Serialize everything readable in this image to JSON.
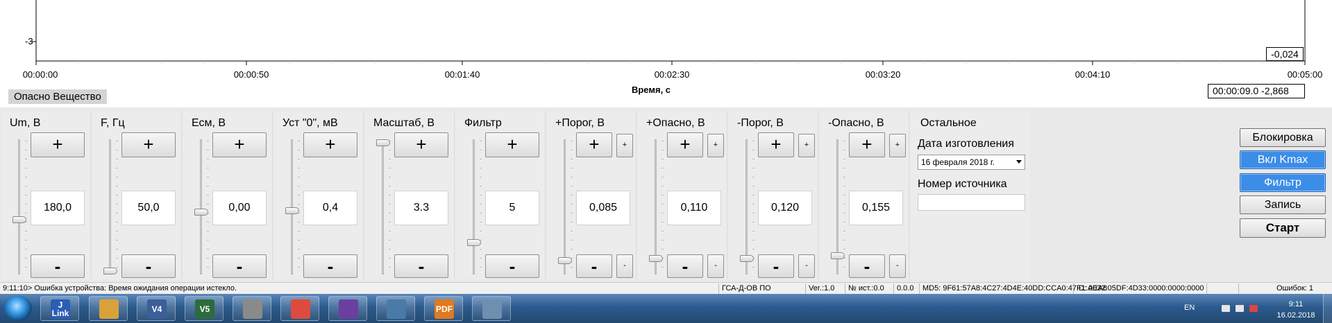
{
  "chart": {
    "y_ticks": [
      "-3"
    ],
    "x_ticks": [
      "00:00:00",
      "00:00:50",
      "00:01:40",
      "00:02:30",
      "00:03:20",
      "00:04:10",
      "00:05:00"
    ],
    "x_label": "Время, с",
    "value_box": "-0,024",
    "cursor_readout": "00:00:09.0  -2,868",
    "channel_label": "Опасно Вещество"
  },
  "panels": [
    {
      "title": "Um, В",
      "value": "180,0",
      "plus": "+",
      "minus": "-",
      "slider_level": 0.4
    },
    {
      "title": "F, Гц",
      "value": "50,0",
      "plus": "+",
      "minus": "-",
      "slider_level": 0.0
    },
    {
      "title": "Есм, В",
      "value": "0,00",
      "plus": "+",
      "minus": "-",
      "slider_level": 0.46
    },
    {
      "title": "Уст \"0\", мВ",
      "value": "0,4",
      "plus": "+",
      "minus": "-",
      "slider_level": 0.47
    },
    {
      "title": "Масштаб, В",
      "value": "3.3",
      "plus": "+",
      "minus": "-",
      "slider_level": 1.0
    },
    {
      "title": "Фильтр",
      "value": "5",
      "plus": "+",
      "minus": "-",
      "slider_level": 0.22
    },
    {
      "title": "+Порог, В",
      "value": "0,085",
      "plus": "+",
      "minus": "-",
      "small_plus": "+",
      "small_minus": "-",
      "slider_level": 0.08
    },
    {
      "title": "+Опасно, В",
      "value": "0,110",
      "plus": "+",
      "minus": "-",
      "small_plus": "+",
      "small_minus": "-",
      "slider_level": 0.1
    },
    {
      "title": "-Порог, В",
      "value": "0,120",
      "plus": "+",
      "minus": "-",
      "small_plus": "+",
      "small_minus": "-",
      "slider_level": 0.1
    },
    {
      "title": "-Опасно, В",
      "value": "0,155",
      "plus": "+",
      "minus": "-",
      "small_plus": "+",
      "small_minus": "-",
      "slider_level": 0.12
    }
  ],
  "other": {
    "title": "Остальное",
    "date_label": "Дата изготовления",
    "date_value": "16 февраля 2018 г.",
    "source_label": "Номер источника",
    "source_value": ""
  },
  "side_buttons": {
    "lock": "Блокировка",
    "kmax": "Вкл Kmax",
    "filter": "Фильтр",
    "record": "Запись",
    "start": "Старт"
  },
  "status_bar": {
    "message": "9:11:10> Ошибка устройства: Время ожидания операции истекло.",
    "device": "ГСА-Д-ОВ ПО",
    "version": "Ver.:1.0",
    "source_no": "№ ист.:0.0",
    "source_val": "0.0.0",
    "md5": "MD5: 9F61:57A8:4C27:4D4E:40DD:CCA0:47F1:AEA6",
    "id": "ID: 0032:05DF:4D33:0000:0000:0000",
    "errors": "Ошибок: 1"
  },
  "taskbar": {
    "apps": [
      {
        "icon": "jlink-icon",
        "text": "J\nLink"
      },
      {
        "icon": "file-explorer-icon",
        "text": ""
      },
      {
        "icon": "ide-v4-icon",
        "text": "V4"
      },
      {
        "icon": "ide-v5-icon",
        "text": "V5"
      },
      {
        "icon": "calculator-icon",
        "text": ""
      },
      {
        "icon": "chrome-icon",
        "text": ""
      },
      {
        "icon": "visual-studio-icon",
        "text": ""
      },
      {
        "icon": "tools-icon",
        "text": ""
      },
      {
        "icon": "pdf-icon",
        "text": "PDF"
      },
      {
        "icon": "network-app-icon",
        "text": ""
      }
    ],
    "lang": "EN",
    "time": "9:11",
    "date": "16.02.2018"
  },
  "colors": {
    "accent_button": "#3c8de8",
    "taskbar": "#2c5a8e"
  }
}
